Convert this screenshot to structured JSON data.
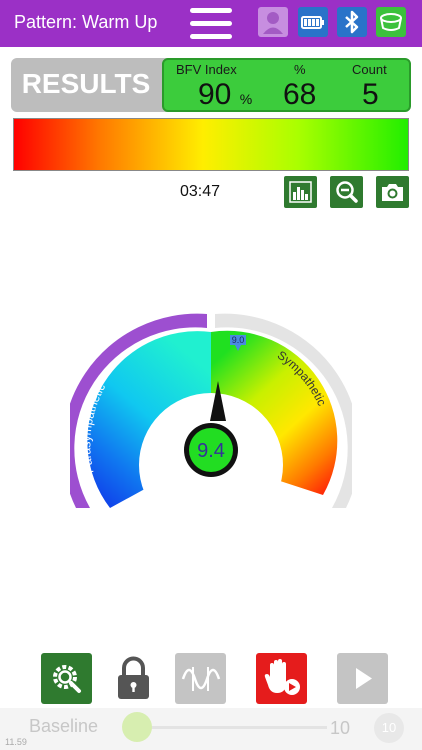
{
  "header": {
    "title": "Pattern: Warm Up",
    "icons": [
      "menu-icon",
      "user-icon",
      "battery-icon",
      "bluetooth-icon",
      "bowl-icon"
    ]
  },
  "results": {
    "label": "RESULTS",
    "bfv_label": "BFV Index",
    "bfv_value": "90",
    "bfv_unit": "%",
    "percent_label": "%",
    "percent_value": "68",
    "count_label": "Count",
    "count_value": "5"
  },
  "timer": "03:47",
  "tools": [
    "bar-chart-icon",
    "zoom-out-icon",
    "camera-icon"
  ],
  "gauge": {
    "left_label": "Parasympathetic",
    "right_label": "Sympathetic",
    "marker_value": "9.0",
    "center_value": "9.4"
  },
  "bottom": {
    "icons": [
      "settings-search-icon",
      "lock-icon",
      "wave-icon",
      "hand-stop-icon",
      "play-icon"
    ],
    "baseline_label": "Baseline",
    "slider_value": "10",
    "slider_badge": "10",
    "slider_level": 0.0
  },
  "version": "11.59",
  "colors": {
    "header": "#9b30c6",
    "accent_green": "#3ccc3c",
    "dark_green": "#2f7a2f",
    "stop_red": "#e51c1c",
    "results_grey": "#bdbdbd",
    "parasympathetic": "#9d4fd0"
  }
}
